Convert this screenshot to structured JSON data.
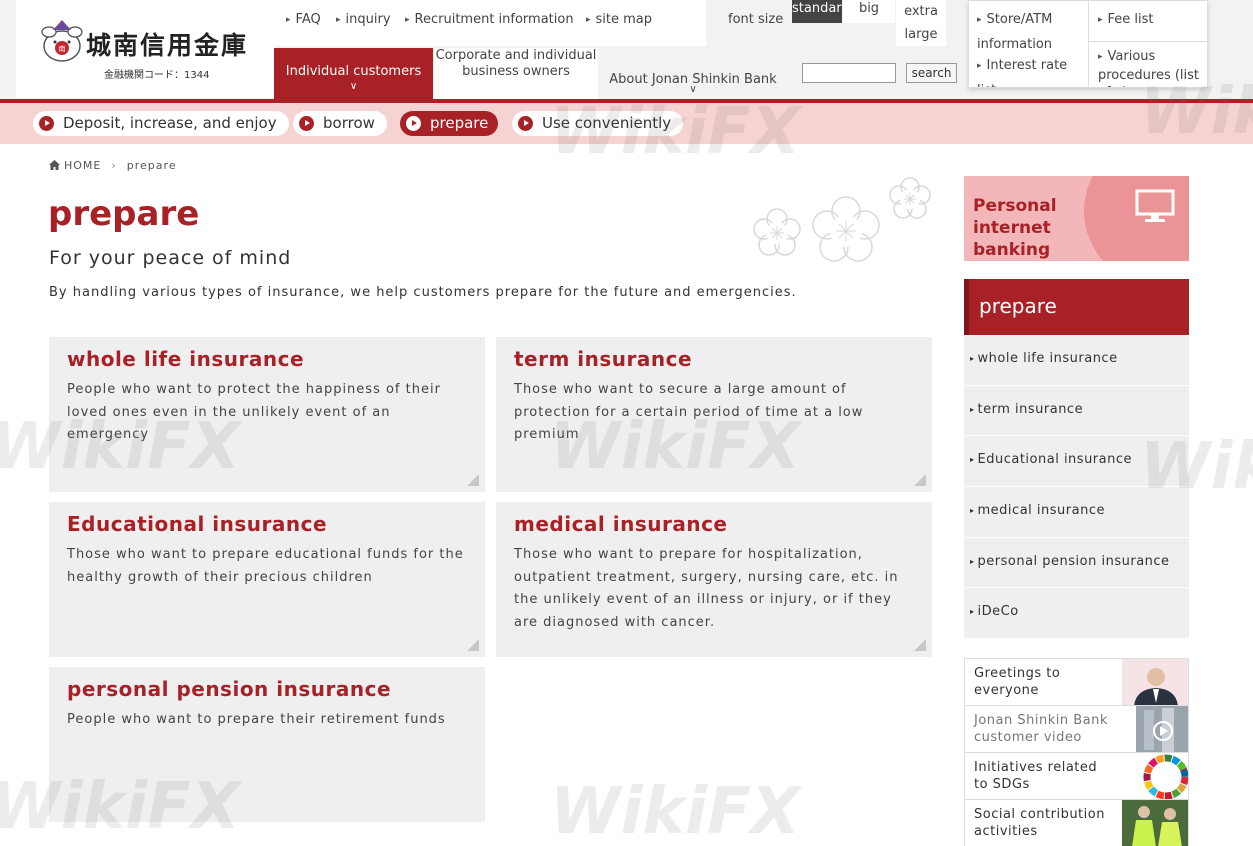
{
  "header": {
    "logo_name": "城南信用金庫",
    "logo_code": "金融機関コード：1344",
    "top_links": [
      "FAQ",
      "inquiry",
      "Recruitment information",
      "site map"
    ],
    "font_size_label": "font size",
    "font_sizes": [
      "standard",
      "big",
      "extra large"
    ],
    "mini_links": [
      "Store/ATM information",
      "Interest rate list",
      "Fee list",
      "Various procedures (list of...)"
    ],
    "global_nav": {
      "individual": "Individual customers",
      "corporate": "Corporate and individual business owners",
      "about": "About Jonan Shinkin Bank"
    },
    "search_button": "search",
    "search_value": ""
  },
  "subnav": [
    "Deposit, increase, and enjoy",
    "borrow",
    "prepare",
    "Use conveniently"
  ],
  "breadcrumb": {
    "home": "HOME",
    "current": "prepare"
  },
  "page": {
    "title": "prepare",
    "subtitle": "For your peace of mind",
    "description": "By handling various types of insurance, we help customers prepare for the future and emergencies."
  },
  "cards": [
    {
      "title": "whole life insurance",
      "text": "People who want to protect the happiness of their loved ones even in the unlikely event of an emergency"
    },
    {
      "title": "term insurance",
      "text": "Those who want to secure a large amount of protection for a certain period of time at a low premium"
    },
    {
      "title": "Educational insurance",
      "text": "Those who want to prepare educational funds for the healthy growth of their precious children"
    },
    {
      "title": "medical insurance",
      "text": "Those who want to prepare for hospitalization, outpatient treatment, surgery, nursing care, etc. in the unlikely event of an illness or injury, or if they are diagnosed with cancer."
    },
    {
      "title": "personal pension insurance",
      "text": "People who want to prepare their retirement funds"
    }
  ],
  "sidebar": {
    "internet_banking": "Personal internet banking",
    "section_title": "prepare",
    "items": [
      "whole life insurance",
      "term insurance",
      "Educational insurance",
      "medical insurance",
      "personal pension insurance",
      "iDeCo"
    ],
    "banners": [
      "Greetings to everyone",
      "Jonan Shinkin Bank customer video",
      "Initiatives related to SDGs",
      "Social contribution activities"
    ]
  },
  "watermark": "WikiFX",
  "colors": {
    "brand": "#a82126",
    "subnav_bg": "#f5d3d3",
    "card_bg": "#efefef"
  }
}
